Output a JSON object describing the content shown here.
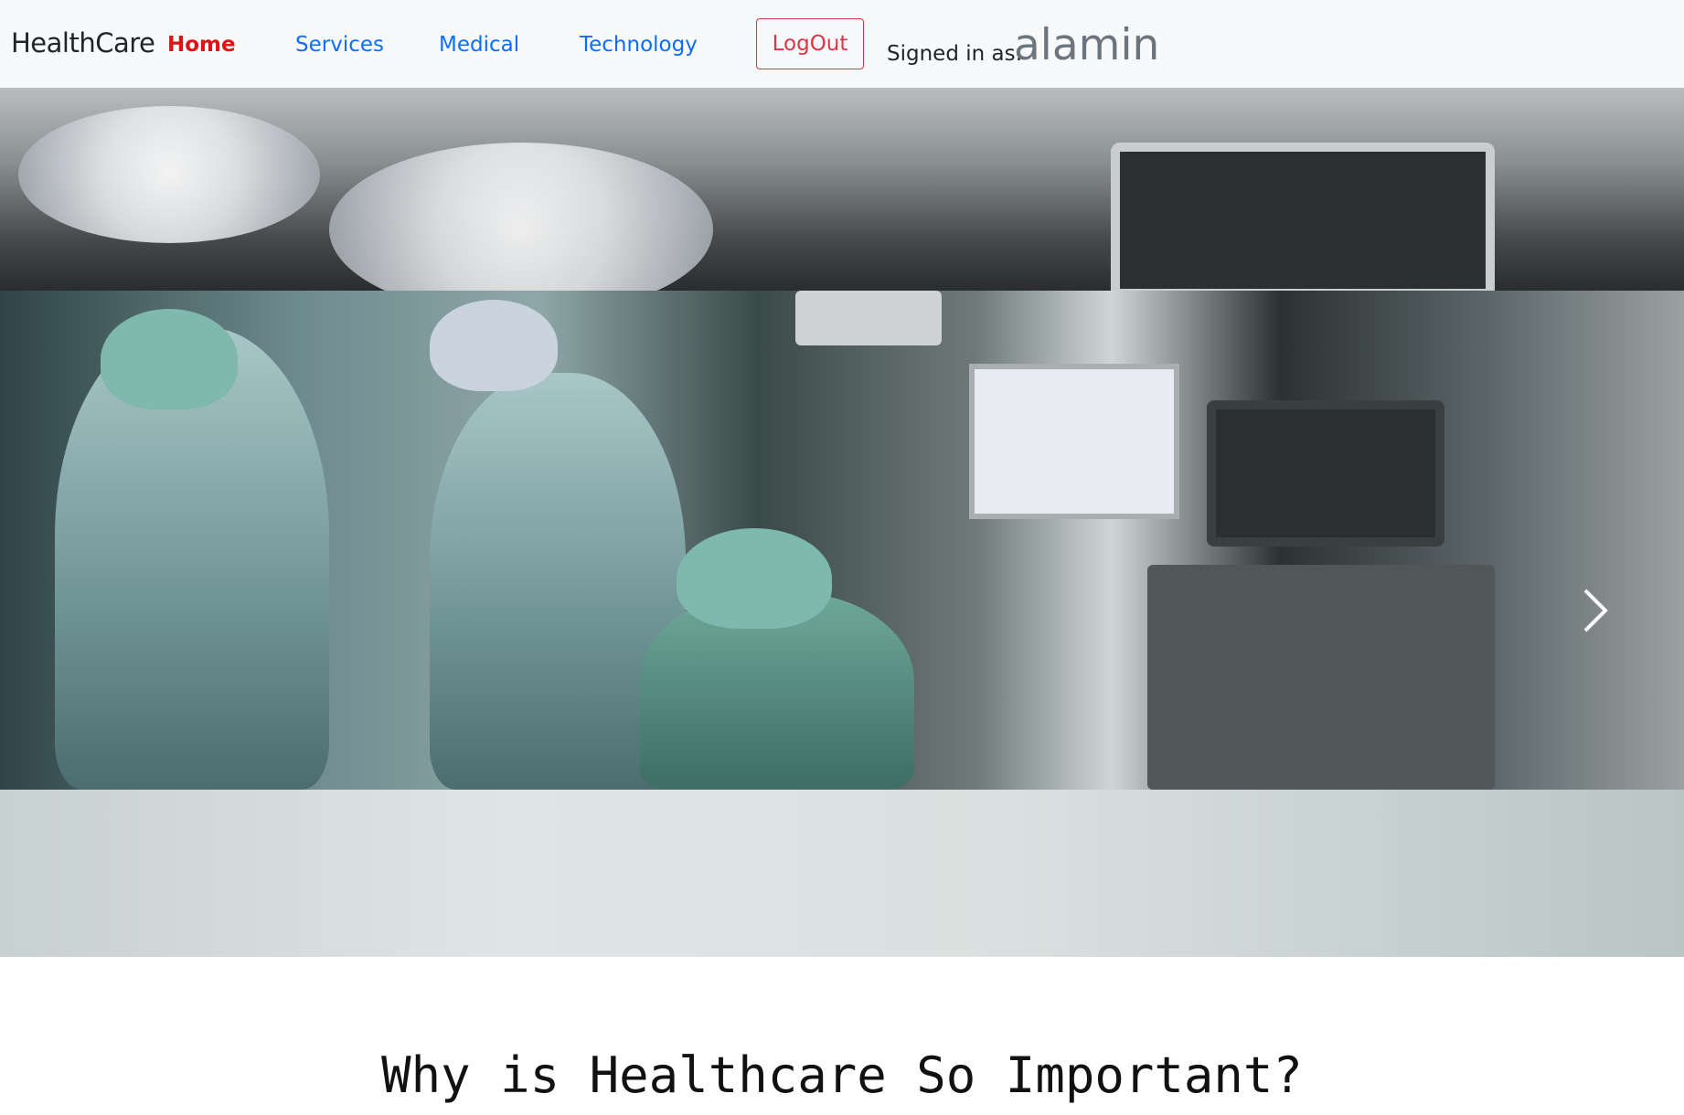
{
  "navbar": {
    "brand": "HealthCare",
    "links": [
      {
        "label": "Home",
        "active": true
      },
      {
        "label": "Services",
        "active": false
      },
      {
        "label": "Medical",
        "active": false
      },
      {
        "label": "Technology",
        "active": false
      }
    ],
    "logout_label": "LogOut",
    "signed_in_label": "Signed in as:",
    "username": "alamin"
  },
  "carousel": {
    "image": "operating-room-surgeons-photo",
    "next_icon": "chevron-right-icon"
  },
  "main": {
    "heading": "Why is Healthcare So Important?"
  },
  "colors": {
    "navbar_bg": "#f8f9fa",
    "link": "#0d6efd",
    "active_link": "#e01212",
    "logout": "#dc3545",
    "username": "#6c757d"
  }
}
